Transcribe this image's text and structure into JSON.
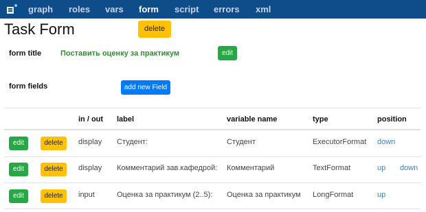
{
  "nav": {
    "items": [
      "graph",
      "roles",
      "vars",
      "form",
      "script",
      "errors",
      "xml"
    ],
    "active": "form"
  },
  "page": {
    "title": "Task Form",
    "delete_label": "delete"
  },
  "form_title": {
    "label": "form title",
    "value": "Поставить оценку за практикум",
    "edit_label": "edit"
  },
  "form_fields": {
    "label": "form fields",
    "add_label": "add new Field"
  },
  "table": {
    "headers": [
      "in / out",
      "label",
      "variable name",
      "type",
      "position"
    ],
    "rows": [
      {
        "edit": "edit",
        "delete": "delete",
        "in_out": "display",
        "label": "Студент:",
        "variable": "Студент",
        "type": "ExecutorFormat",
        "up": "",
        "down": "down"
      },
      {
        "edit": "edit",
        "delete": "delete",
        "in_out": "display",
        "label": "Комментарий зав.кафедрой:",
        "variable": "Комментарий",
        "type": "TextFormat",
        "up": "up",
        "down": "down"
      },
      {
        "edit": "edit",
        "delete": "delete",
        "in_out": "input",
        "label": "Оценка за практикум (2..5):",
        "variable": "Оценка за практикум",
        "type": "LongFormat",
        "up": "up",
        "down": ""
      }
    ]
  },
  "colors": {
    "navbar": "#0f4d8a",
    "warning": "#ffc107",
    "success": "#28a745",
    "primary": "#007bff",
    "title_green": "#2e8b2e",
    "link": "#3b7cc4"
  }
}
